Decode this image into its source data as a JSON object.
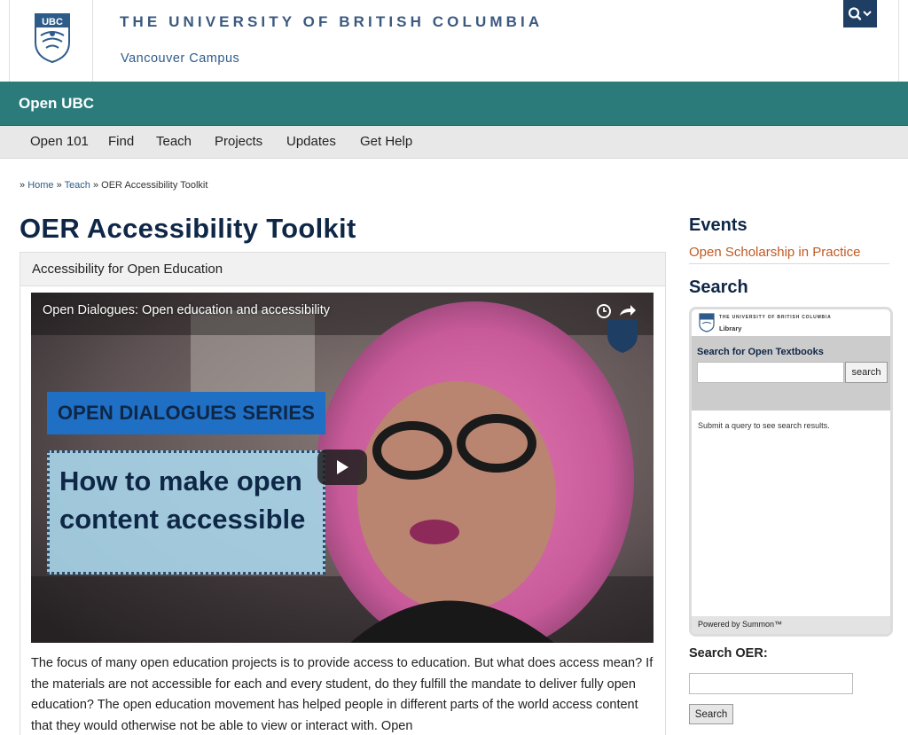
{
  "header": {
    "crest_text": "UBC",
    "university_name": "THE UNIVERSITY OF BRITISH COLUMBIA",
    "campus": "Vancouver Campus",
    "search_icon": "search-icon",
    "chevron_icon": "chevron-down-icon"
  },
  "site": {
    "title": "Open UBC"
  },
  "nav": {
    "items": [
      {
        "label": "Open 101"
      },
      {
        "label": "Find"
      },
      {
        "label": "Teach"
      },
      {
        "label": "Projects"
      },
      {
        "label": "Updates"
      },
      {
        "label": "Get Help"
      }
    ]
  },
  "breadcrumb": {
    "home": "Home",
    "teach": "Teach",
    "current": "OER Accessibility Toolkit"
  },
  "main": {
    "title": "OER Accessibility Toolkit",
    "box_heading": "Accessibility for Open Education",
    "video": {
      "title": "Open Dialogues: Open education and accessibility",
      "series": "OPEN DIALOGUES SERIES",
      "headline_line1": "How to make open",
      "headline_line2": "content accessible"
    },
    "body": "The focus of many open education projects is to provide access to education. But what does access mean? If the materials are not accessible for each and every student, do they fulfill the mandate to deliver fully open education? The open education movement has helped people in different parts of the world access content that they would otherwise not be able to view or interact with. Open"
  },
  "sidebar": {
    "events_heading": "Events",
    "event_link": "Open Scholarship in Practice",
    "search_heading": "Search",
    "summon": {
      "univ_name": "THE UNIVERSITY OF BRITISH COLUMBIA",
      "library": "Library",
      "label": "Search for Open Textbooks",
      "button": "search",
      "result_text": "Submit a query to see search results.",
      "footer": "Powered by Summon™"
    },
    "oer_heading": "Search OER:",
    "oer_button": "Search"
  },
  "colors": {
    "teal_bar": "#2b7b7b",
    "navy": "#0f2747",
    "event_link": "#c25a23"
  }
}
